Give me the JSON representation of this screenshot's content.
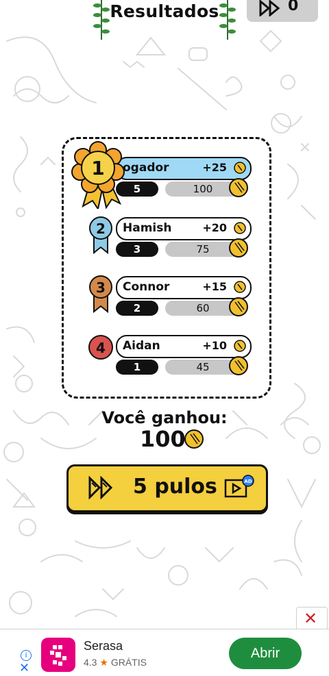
{
  "header": {
    "title": "Resultados",
    "skips_count": "0"
  },
  "results": [
    {
      "rank": "1",
      "name": "ogador",
      "points": "+25",
      "level": "5",
      "coins": "100",
      "medal_color": "#f3c232"
    },
    {
      "rank": "2",
      "name": "Hamish",
      "points": "+20",
      "level": "3",
      "coins": "75",
      "medal_color": "#8ecae6"
    },
    {
      "rank": "3",
      "name": "Connor",
      "points": "+15",
      "level": "2",
      "coins": "60",
      "medal_color": "#d4894a"
    },
    {
      "rank": "4",
      "name": "Aidan",
      "points": "+10",
      "level": "1",
      "coins": "45",
      "medal_color": "#d9534f"
    }
  ],
  "earnings": {
    "label": "Você ganhou:",
    "amount": "100"
  },
  "skip_button": {
    "label": "5 pulos",
    "ad_badge": "AD"
  },
  "ad": {
    "app_name": "Serasa",
    "rating": "4.3",
    "price": "GRÁTIS",
    "cta": "Abrir",
    "close_symbol": "✕",
    "brand_color": "#e6007e"
  }
}
